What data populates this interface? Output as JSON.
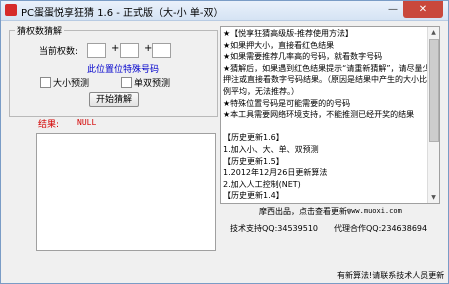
{
  "window": {
    "title": "PC蛋蛋悦享狂猜 1.6 - 正式版（大-小 单-双）",
    "minimize_glyph": "—",
    "close_glyph": "✕",
    "accent_color": "#d62b2b"
  },
  "panel": {
    "group_title": "猜权数猜解",
    "weight_label": "当前权数:",
    "plus_1": "+",
    "plus_2": "+",
    "special_link": "此位置位特殊号码",
    "option_big_small": "大小预测",
    "option_odd_even": "单双预测",
    "start_button": "开始猜解",
    "result_label": "结果:",
    "result_value": "NULL"
  },
  "info": {
    "text": "★【悦享狂猜高级版-推荐使用方法】\n★如果押大小，直接看红色结果\n★如果需要推荐几率高的号码，就看数字号码\n★猜解后，如果遇到红色结果提示“请重新猜解”，请尽量少押注或直接看数字号码结果。（原因是结果中产生的大小比例平均，无法推荐。）\n★特殊位置号码是可能需要的的号码\n★本工具需要网络环境支持，不能推测已经开奖的结果\n\n【历史更新1.6】\n1.加入小、大、单、双预测\n【历史更新1.5】\n1.2012年12月26日更新算法\n2.加入人工控制(NET)\n【历史更新1.4】"
  },
  "credits": {
    "producer": "摩西出品，点击查看更新：",
    "site": "www.muoxi.com",
    "support": "技术支持QQ:34539510",
    "agent": "代理合作QQ:234638694",
    "footer": "有新算法!请联系技术人员更新"
  }
}
